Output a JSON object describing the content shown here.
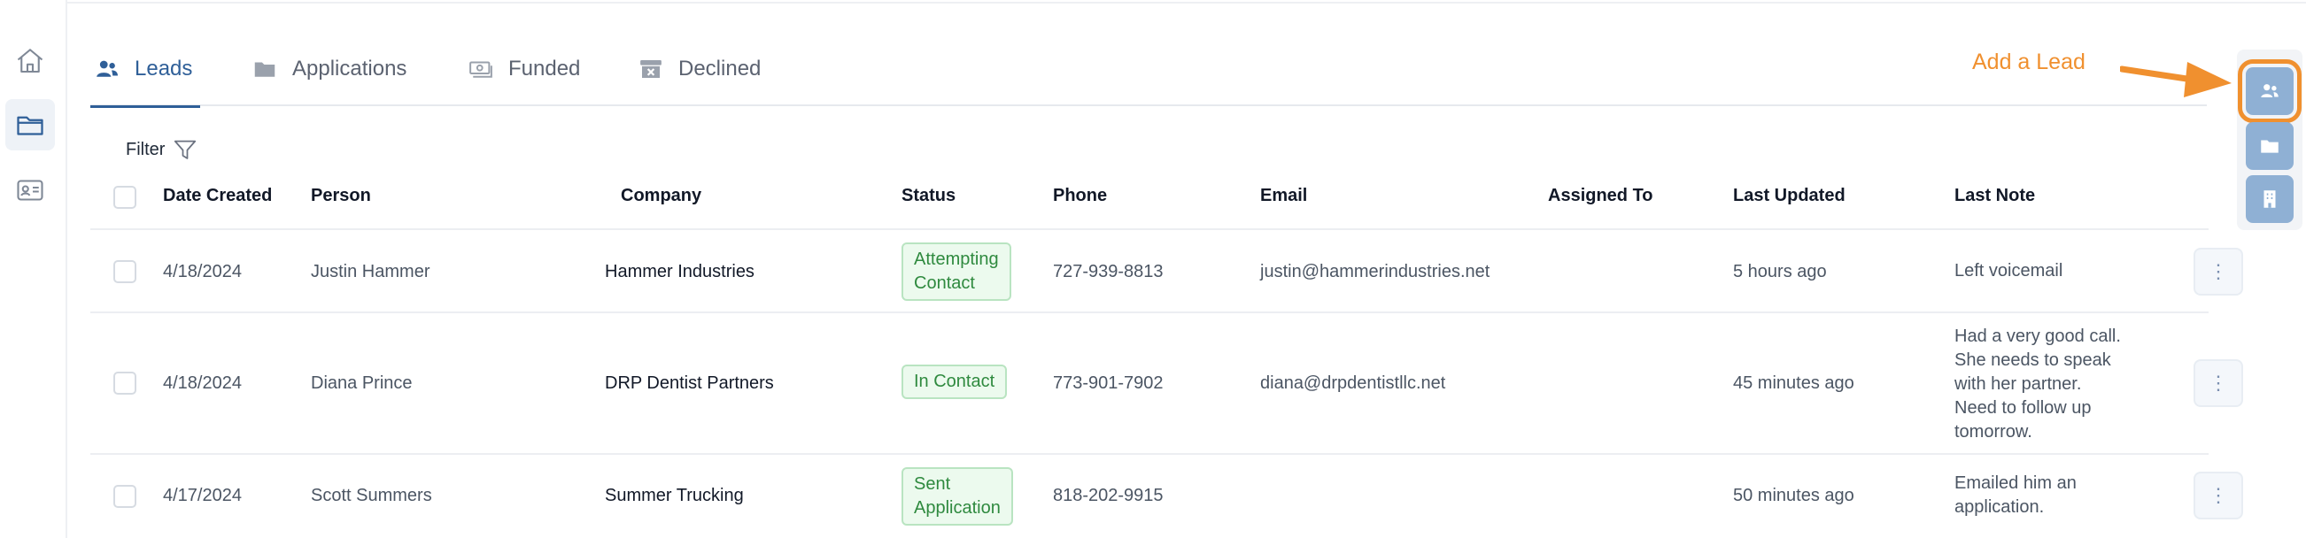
{
  "nav": {
    "items": [
      {
        "icon": "home-icon"
      },
      {
        "icon": "folder-icon",
        "active": true
      },
      {
        "icon": "contact-card-icon"
      }
    ]
  },
  "tabs": [
    {
      "label": "Leads",
      "icon": "users-icon",
      "active": true
    },
    {
      "label": "Applications",
      "icon": "folder-icon"
    },
    {
      "label": "Funded",
      "icon": "money-icon"
    },
    {
      "label": "Declined",
      "icon": "archive-x-icon"
    }
  ],
  "hint": {
    "label": "Add a Lead",
    "color": "#f0902f"
  },
  "side_panel": [
    {
      "icon": "users-icon",
      "highlighted": true
    },
    {
      "icon": "folder-icon"
    },
    {
      "icon": "building-icon"
    }
  ],
  "filter": {
    "label": "Filter"
  },
  "table": {
    "columns": [
      "Date Created",
      "Person",
      "Company",
      "Status",
      "Phone",
      "Email",
      "Assigned To",
      "Last Updated",
      "Last Note"
    ],
    "rows": [
      {
        "date": "4/18/2024",
        "person": "Justin Hammer",
        "company": "Hammer Industries",
        "status": [
          "Attempting",
          "Contact"
        ],
        "phone": "727-939-8813",
        "email": "justin@hammerindustries.net",
        "assigned": "",
        "updated": "5 hours ago",
        "note": [
          "Left voicemail"
        ]
      },
      {
        "date": "4/18/2024",
        "person": "Diana Prince",
        "company": "DRP Dentist Partners",
        "status": [
          "In Contact"
        ],
        "phone": "773-901-7902",
        "email": "diana@drpdentistllc.net",
        "assigned": "",
        "updated": "45 minutes ago",
        "note": [
          "Had a very good call.",
          "She needs to speak",
          "with her partner.",
          "Need to follow up",
          "tomorrow."
        ]
      },
      {
        "date": "4/17/2024",
        "person": "Scott Summers",
        "company": "Summer Trucking",
        "status": [
          "Sent",
          "Application"
        ],
        "phone": "818-202-9915",
        "email": "",
        "assigned": "",
        "updated": "50 minutes ago",
        "note": [
          "Emailed him an",
          "application."
        ]
      }
    ]
  },
  "colors": {
    "accent": "#2f5f98",
    "status_bg": "#ecfaee",
    "status_text": "#2f8a3f",
    "highlight": "#f0902f"
  }
}
